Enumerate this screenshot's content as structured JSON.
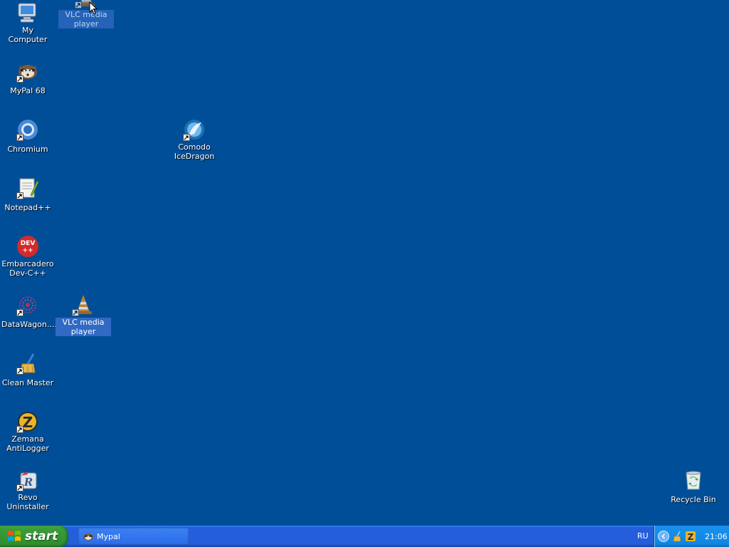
{
  "desktop": {
    "background_color": "#004e98",
    "icons": [
      {
        "label": "My Computer",
        "icon": "my-computer-icon"
      },
      {
        "label": "MyPal 68",
        "icon": "mypal-icon"
      },
      {
        "label": "Chromium",
        "icon": "chromium-icon"
      },
      {
        "label": "Notepad++",
        "icon": "notepad-plus-plus-icon"
      },
      {
        "label": "Embarcadero Dev-C++",
        "icon": "dev-cpp-icon"
      },
      {
        "label": "DataWagon....",
        "icon": "datawagon-icon"
      },
      {
        "label": "Clean Master",
        "icon": "clean-master-icon"
      },
      {
        "label": "Zemana AntiLogger",
        "icon": "zemana-icon"
      },
      {
        "label": "Revo Uninstaller",
        "icon": "revo-uninstaller-icon"
      },
      {
        "label": "Comodo IceDragon",
        "icon": "icedragon-icon"
      },
      {
        "label": "VLC media player",
        "icon": "vlc-icon",
        "state": "selected"
      },
      {
        "label": "VLC media player",
        "icon": "vlc-icon",
        "state": "being-dragged"
      },
      {
        "label": "Recycle Bin",
        "icon": "recycle-bin-icon"
      }
    ]
  },
  "taskbar": {
    "start_label": "start",
    "tasks": [
      {
        "label": "Mypal",
        "icon": "mypal-icon"
      }
    ],
    "language": "RU",
    "clock": "21:06",
    "tray_icons": [
      "show-hidden-icons-icon",
      "clean-master-tray-icon",
      "zemana-tray-icon"
    ]
  },
  "colors": {
    "desktop": "#004e98",
    "taskbar": "#245edb",
    "start_button": "#3a9e3a",
    "tray": "#0f86e2",
    "selection": "#316ac5"
  }
}
